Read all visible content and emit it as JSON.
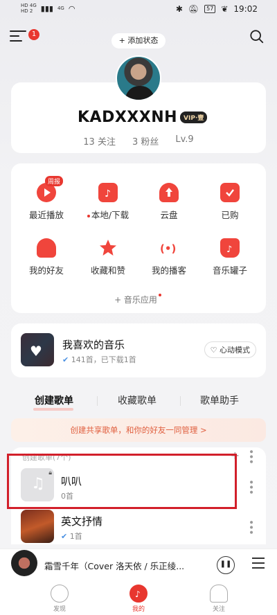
{
  "status_bar": {
    "left_small_1": "HD 4G",
    "left_small_2": "HD 2",
    "left_signal": "4G",
    "battery": "57",
    "time": "19:02"
  },
  "header": {
    "menu_badge": "1",
    "add_status": "+ 添加状态"
  },
  "profile": {
    "username": "KADXXXNH",
    "vip_badge": "VIP·壹",
    "following": "13 关注",
    "followers": "3 粉丝",
    "level": "Lv.9"
  },
  "functions": {
    "recent_tag": "周报",
    "items": [
      {
        "label": "最近播放"
      },
      {
        "label": "本地/下载"
      },
      {
        "label": "云盘"
      },
      {
        "label": "已购"
      },
      {
        "label": "我的好友"
      },
      {
        "label": "收藏和赞"
      },
      {
        "label": "我的播客"
      },
      {
        "label": "音乐罐子"
      }
    ],
    "music_app": "+ 音乐应用"
  },
  "liked": {
    "title": "我喜欢的音乐",
    "subtitle": "141首，已下载1首",
    "mode_button": "心动模式"
  },
  "tabs": [
    "创建歌单",
    "收藏歌单",
    "歌单助手"
  ],
  "banner": "创建共享歌单，和你的好友一同管理 >",
  "playlists": {
    "section_head": "创建歌单(7个)",
    "items": [
      {
        "title": "叭叭",
        "subtitle": "0首"
      },
      {
        "title": "英文抒情",
        "subtitle": "1首"
      }
    ]
  },
  "player": {
    "title": "霜雪千年（Cover 洛天依 / 乐正绫..."
  },
  "bottom_nav": [
    {
      "label": "发现"
    },
    {
      "label": "我的"
    },
    {
      "label": "关注"
    }
  ],
  "colors": {
    "accent": "#e8372f",
    "highlight_box": "#d21f2a"
  }
}
